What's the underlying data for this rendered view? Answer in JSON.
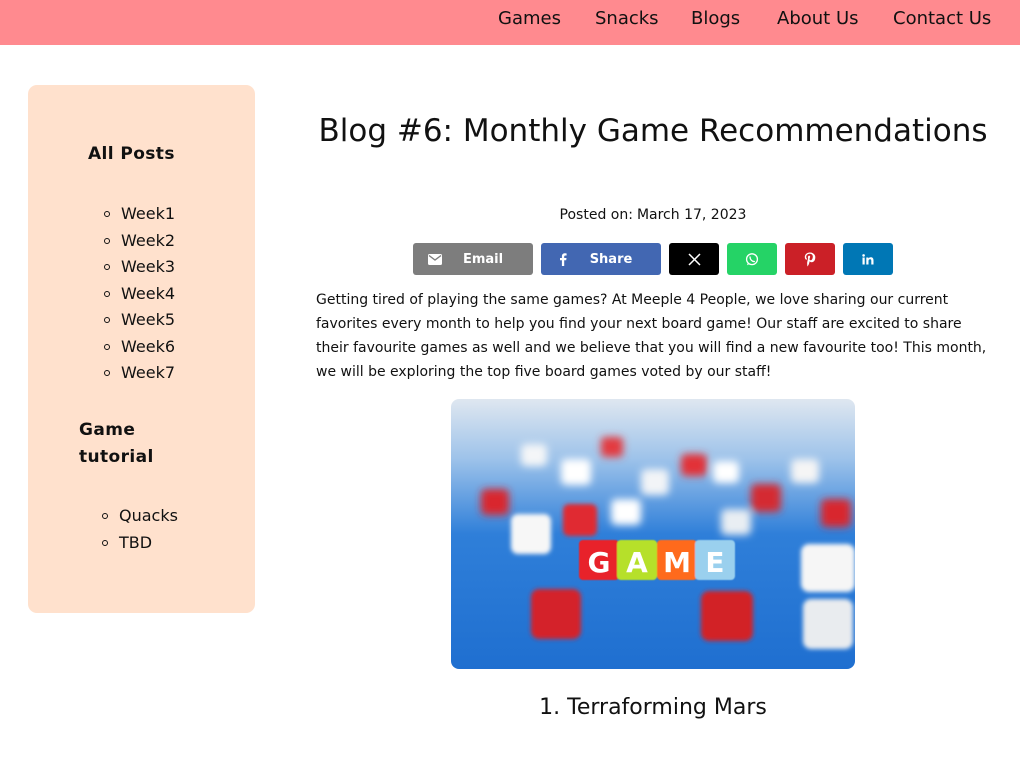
{
  "nav": {
    "items": [
      "Games",
      "Snacks",
      "Blogs",
      "About Us",
      "Contact Us"
    ]
  },
  "sidebar": {
    "posts_heading": "All Posts",
    "posts": [
      "Week1",
      "Week2",
      "Week3",
      "Week4",
      "Week5",
      "Week6",
      "Week7"
    ],
    "tutorial_heading": "Game tutorial",
    "tutorials": [
      "Quacks",
      "TBD"
    ]
  },
  "post": {
    "title": "Blog #6: Monthly Game Recommendations",
    "posted_label": "Posted on:",
    "posted_date": "March 17, 2023",
    "intro": "Getting tired of playing the same games? At Meeple 4 People, we love sharing our current favorites every month to help you find your next board game! Our staff are excited to share their favourite games as well and we believe that you will find a new favourite too! This month, we will be exploring the top five board games voted by our staff!",
    "section_1_title": "1. Terraforming Mars"
  },
  "share": {
    "email_label": "Email",
    "facebook_label": "Share",
    "buttons": [
      {
        "name": "email",
        "color": "#7d7d7d",
        "icon": "envelope-icon"
      },
      {
        "name": "facebook",
        "color": "#4267b2",
        "icon": "facebook-icon"
      },
      {
        "name": "x",
        "color": "#000000",
        "icon": "x-icon"
      },
      {
        "name": "whatsapp",
        "color": "#25d366",
        "icon": "whatsapp-icon"
      },
      {
        "name": "pinterest",
        "color": "#cb2027",
        "icon": "pinterest-icon"
      },
      {
        "name": "linkedin",
        "color": "#0077b5",
        "icon": "linkedin-icon"
      }
    ]
  },
  "hero_image": {
    "letters": [
      "G",
      "A",
      "M",
      "E"
    ]
  },
  "theme": {
    "nav_bg": "#ff8a8f",
    "sidebar_bg": "#ffe1cd"
  }
}
